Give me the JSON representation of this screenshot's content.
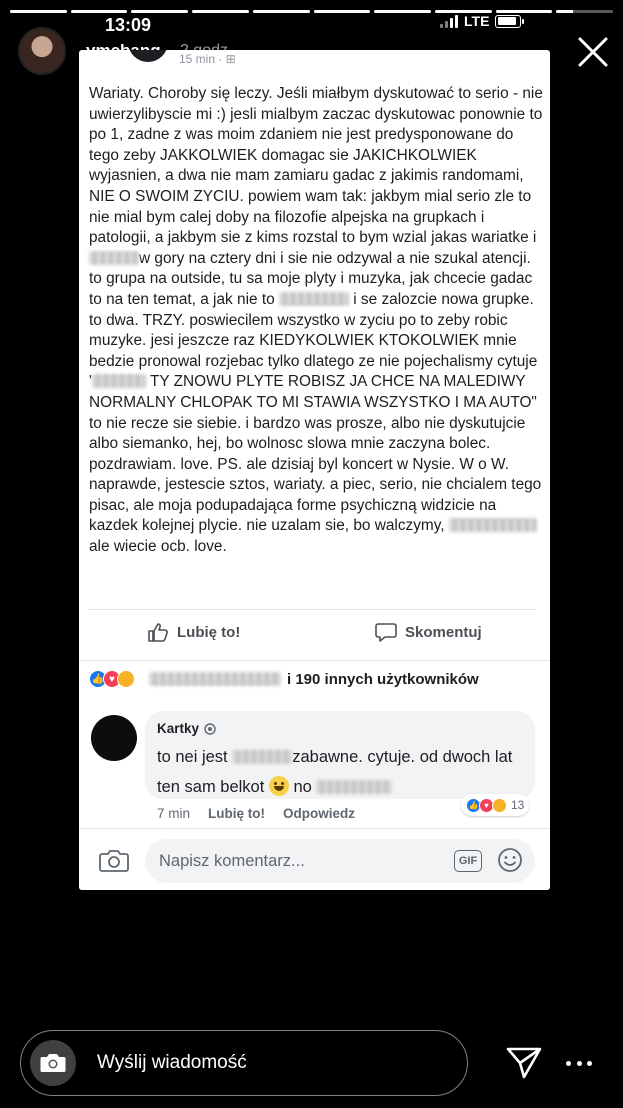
{
  "status_bar": {
    "time": "13:09",
    "network": "LTE",
    "battery_level": 0.85
  },
  "story": {
    "progress": [
      1,
      1,
      1,
      1,
      1,
      1,
      1,
      1,
      1,
      0.3
    ],
    "username": "vmcbang",
    "time_ago": "2 godz."
  },
  "post": {
    "header_meta": "15 min · ⊞",
    "text_parts": {
      "p1": "Wariaty. Choroby się leczy. Jeśli miałbym dyskutować to serio - nie uwierzylibyscie mi :) jesli mialbym zaczac dyskutowac ponownie to po 1, zadne z was moim zdaniem nie jest predysponowane do tego zeby JAKKOLWIEK domagac sie JAKICHKOLWIEK wyjasnien, a dwa nie mam zamiaru gadac z jakimis randomami, NIE O SWOIM ZYCIU. powiem wam tak: jakbym mial serio zle to nie mial bym calej doby na filozofie alpejska na grupkach i patologii, a jakbym sie  z kims rozstal to bym wzial jakas wariatke i",
      "p2": "w gory na cztery dni i sie nie odzywal a nie szukal atencji. to grupa na outside, tu sa moje plyty i muzyka, jak chcecie gadac to na ten temat, a jak nie to",
      "p3": "i se zalozcie nowa grupke. to dwa. TRZY. poswiecilem wszystko w zyciu po to zeby robic muzyke. jesi jeszcze raz KIEDYKOLWIEK KTOKOLWIEK mnie bedzie pronowal rozjebac tylko dlatego ze nie pojechalismy cytuje '",
      "p4": "TY ZNOWU PLYTE ROBISZ JA CHCE NA MALEDIWY NORMALNY CHLOPAK TO MI STAWIA WSZYSTKO I MA AUTO\" to nie recze sie siebie. i bardzo was prosze, albo nie dyskutujcie albo siemanko, hej, bo wolnosc slowa mnie zaczyna bolec. pozdrawiam. love. PS. ale dzisiaj byl koncert w Nysie. W o W. naprawde, jestescie sztos, wariaty. a piec, serio, nie chcialem tego pisac, ale moja podupadająca forme psychiczną widzicie na kazdek kolejnej plycie. nie uzalam sie, bo walczymy,",
      "p5": "ale wiecie ocb. love."
    },
    "like_label": "Lubię to!",
    "comment_label": "Skomentuj",
    "reactions_summary": "i 190 innych użytkowników"
  },
  "comment": {
    "author": "Kartky",
    "text_a": "to nei jest",
    "text_b": "zabawne. cytuje. od dwoch lat ten sam belkot",
    "text_c": "no",
    "time": "7 min",
    "like": "Lubię to!",
    "reply": "Odpowiedz",
    "reaction_count": "13"
  },
  "composer": {
    "placeholder": "Napisz komentarz...",
    "gif_label": "GIF"
  },
  "reply_bar": {
    "placeholder": "Wyślij wiadomość"
  },
  "colors": {
    "fb_blue": "#1877f2",
    "love_red": "#f33e58",
    "haha_yellow": "#f7b125",
    "text_dark": "#1c1e21",
    "text_gray": "#606770"
  }
}
